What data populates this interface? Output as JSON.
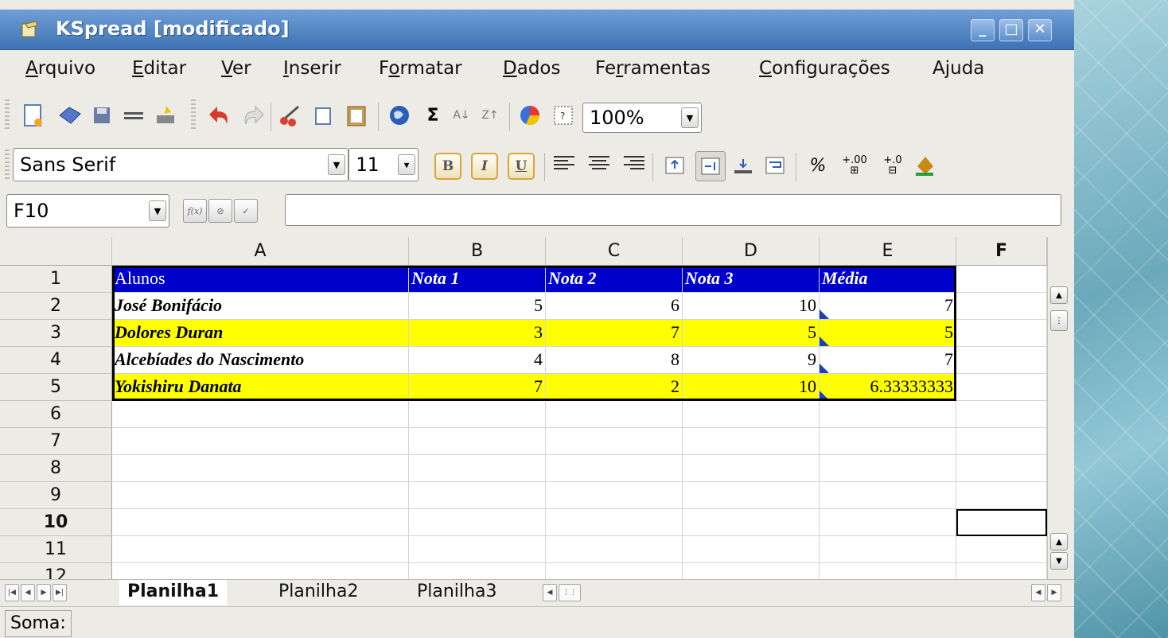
{
  "window": {
    "title": "KSpread [modificado]"
  },
  "menu": [
    "Arquivo",
    "Editar",
    "Ver",
    "Inserir",
    "Formatar",
    "Dados",
    "Ferramentas",
    "Configurações",
    "Ajuda"
  ],
  "menu_mnemonic_index": [
    0,
    0,
    0,
    0,
    1,
    0,
    2,
    0,
    1
  ],
  "toolbar": {
    "zoom": "100%",
    "font_name": "Sans Serif",
    "font_size": "11",
    "bold_label": "B",
    "italic_label": "I",
    "underline_label": "U",
    "percent_label": "%",
    "sum_label": "Σ"
  },
  "editbar": {
    "cell_ref": "F10",
    "formula": ""
  },
  "columns": [
    "A",
    "B",
    "C",
    "D",
    "E",
    "F"
  ],
  "rows": [
    "1",
    "2",
    "3",
    "4",
    "5",
    "6",
    "7",
    "8",
    "9",
    "10",
    "11",
    "12"
  ],
  "cells": {
    "header": [
      "Alunos",
      "Nota 1",
      "Nota 2",
      "Nota 3",
      "Média"
    ],
    "data": [
      [
        "José Bonifácio",
        "5",
        "6",
        "10",
        "7"
      ],
      [
        "Dolores Duran",
        "3",
        "7",
        "5",
        "5"
      ],
      [
        "Alcebíades do Nascimento",
        "4",
        "8",
        "9",
        "7"
      ],
      [
        "Yokishiru Danata",
        "7",
        "2",
        "10",
        "6.33333333"
      ]
    ]
  },
  "colors": {
    "header_bg": "#0000cc",
    "header_fg": "#ffffff",
    "highlight_bg": "#ffff00"
  },
  "tabs": [
    "Planilha1",
    "Planilha2",
    "Planilha3"
  ],
  "active_tab": "Planilha1",
  "status": {
    "label": "Soma:"
  }
}
